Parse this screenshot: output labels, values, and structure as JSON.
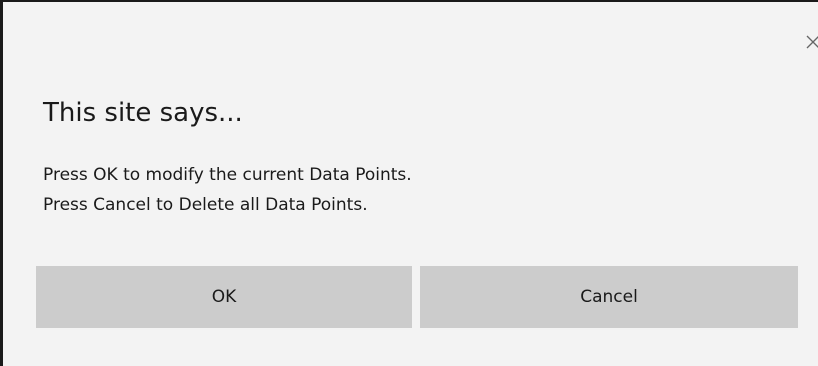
{
  "dialog": {
    "title": "This site says...",
    "message_lines": [
      "Press OK to modify the current Data Points.",
      "Press Cancel to Delete all Data Points."
    ],
    "close_icon": "close-icon",
    "buttons": {
      "ok_label": "OK",
      "cancel_label": "Cancel"
    }
  },
  "colors": {
    "background": "#f3f3f3",
    "button": "#cccccc",
    "text": "#1a1a1a",
    "close_icon": "#666666"
  }
}
